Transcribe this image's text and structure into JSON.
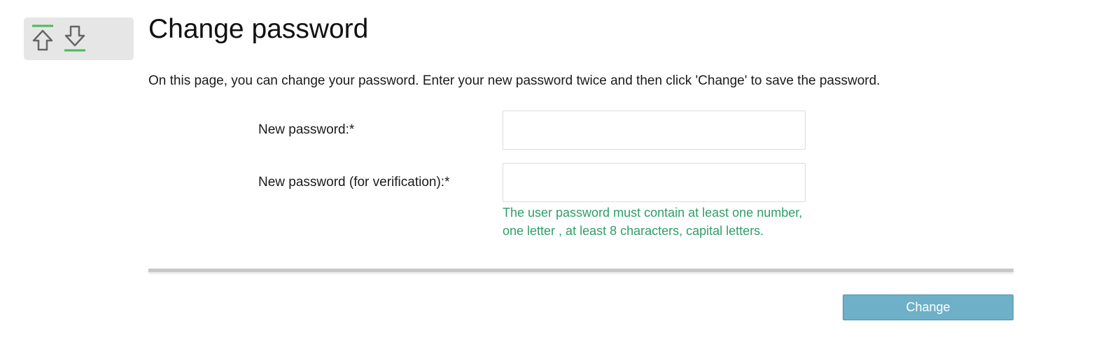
{
  "toolbar": {
    "buttons": [
      {
        "icon": "move-to-top-icon",
        "accent": "#4cb85a"
      },
      {
        "icon": "move-to-bottom-icon",
        "accent": "#4cb85a"
      }
    ]
  },
  "page": {
    "title": "Change password",
    "intro": "On this page, you can change your password. Enter your new password twice and then click 'Change' to save the password."
  },
  "form": {
    "new_password": {
      "label": "New password:*",
      "value": "",
      "placeholder": ""
    },
    "verify_password": {
      "label": "New password (for verification):*",
      "value": "",
      "placeholder": ""
    },
    "hint": "The user password must contain at least one number, one letter , at least 8 characters, capital letters."
  },
  "actions": {
    "change_label": "Change"
  },
  "colors": {
    "hint": "#2f9e69",
    "button": "#6eb0c8",
    "icon_accent": "#4cb85a"
  }
}
